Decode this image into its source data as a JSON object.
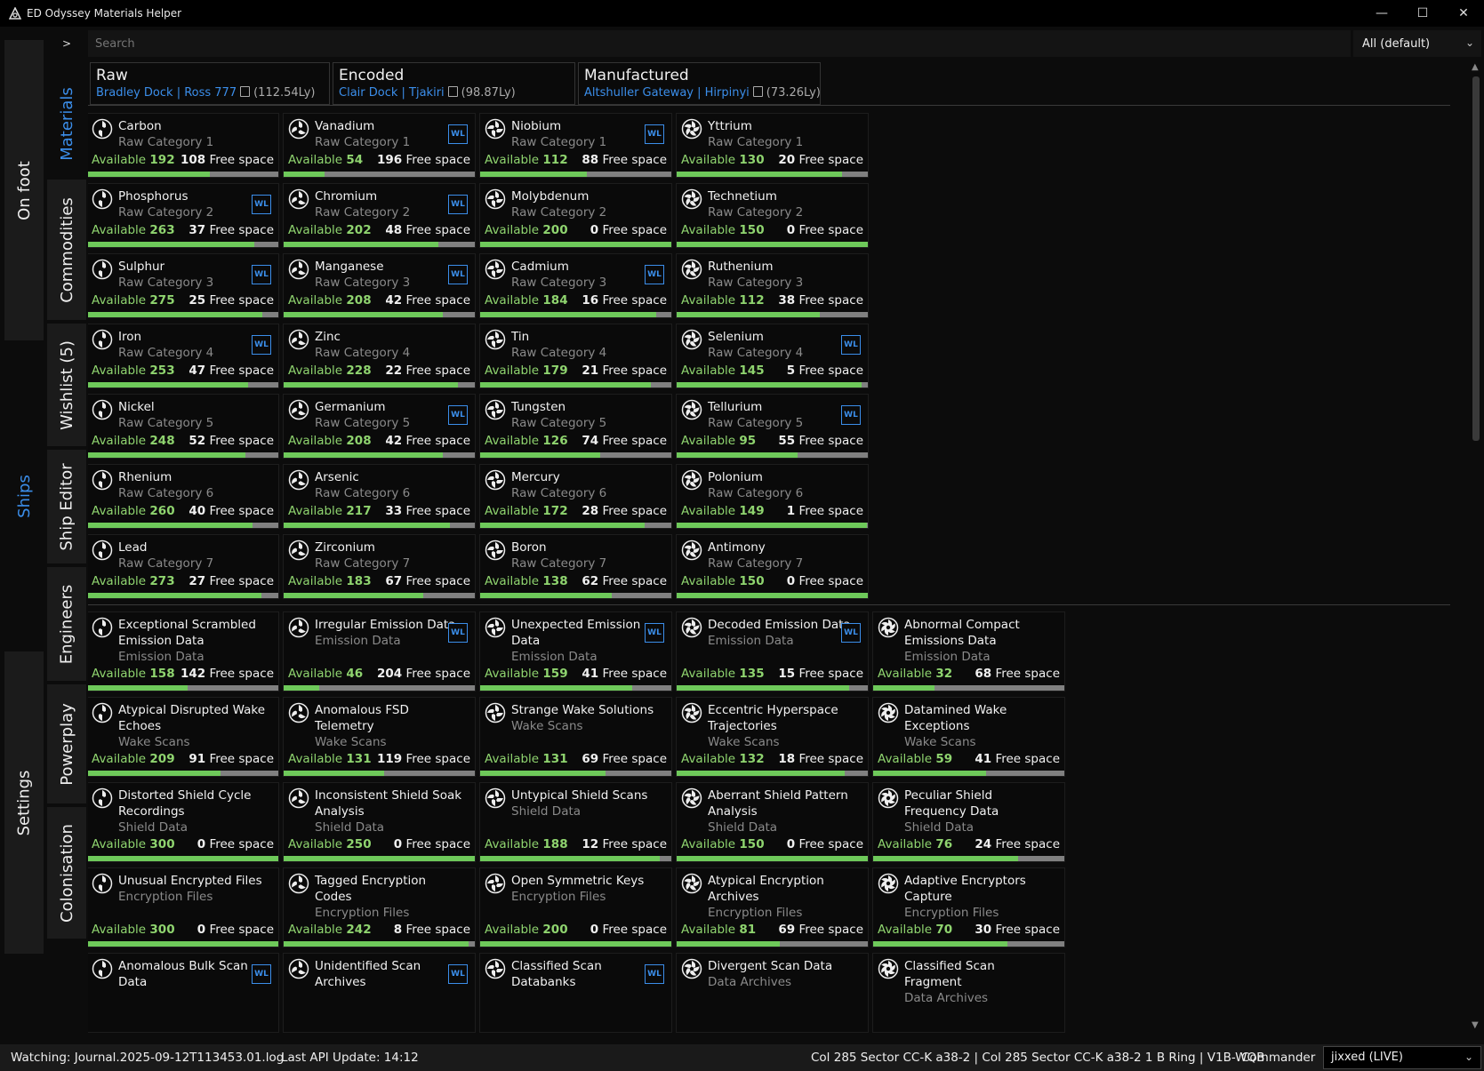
{
  "window": {
    "title": "ED Odyssey Materials Helper",
    "controls": [
      "minimize-icon",
      "maximize-icon",
      "close-icon"
    ]
  },
  "outer_tabs": [
    {
      "label": "On foot",
      "active": false
    },
    {
      "label": "Ships",
      "active": true
    },
    {
      "label": "Settings",
      "active": false
    }
  ],
  "inner_tabs": [
    {
      "label": "Materials",
      "active": true
    },
    {
      "label": "Commodities",
      "active": false
    },
    {
      "label": "Wishlist (5)",
      "active": false
    },
    {
      "label": "Ship Editor",
      "active": false
    },
    {
      "label": "Engineers",
      "active": false
    },
    {
      "label": "Powerplay",
      "active": false
    },
    {
      "label": "Colonisation",
      "active": false
    }
  ],
  "toolbar": {
    "expand_label": ">",
    "search_placeholder": "Search",
    "filter_value": "All (default)"
  },
  "traders": [
    {
      "name": "Raw",
      "location": "Bradley Dock | Ross 777",
      "distance": "(112.54Ly)"
    },
    {
      "name": "Encoded",
      "location": "Clair Dock | Tjakiri",
      "distance": "(98.87Ly)"
    },
    {
      "name": "Manufactured",
      "location": "Altshuller Gateway | Hirpinyi",
      "distance": "(73.26Ly)"
    }
  ],
  "labels": {
    "available": "Available",
    "free_space": "Free space",
    "wishlist_badge": "WL"
  },
  "raw_materials": [
    {
      "name": "Carbon",
      "category": "Raw Category 1",
      "available": 192,
      "free": 108,
      "wl": false,
      "grade": 1
    },
    {
      "name": "Vanadium",
      "category": "Raw Category 1",
      "available": 54,
      "free": 196,
      "wl": true,
      "grade": 2
    },
    {
      "name": "Niobium",
      "category": "Raw Category 1",
      "available": 112,
      "free": 88,
      "wl": true,
      "grade": 3
    },
    {
      "name": "Yttrium",
      "category": "Raw Category 1",
      "available": 130,
      "free": 20,
      "wl": false,
      "grade": 4
    },
    {
      "name": "Phosphorus",
      "category": "Raw Category 2",
      "available": 263,
      "free": 37,
      "wl": true,
      "grade": 1
    },
    {
      "name": "Chromium",
      "category": "Raw Category 2",
      "available": 202,
      "free": 48,
      "wl": true,
      "grade": 2
    },
    {
      "name": "Molybdenum",
      "category": "Raw Category 2",
      "available": 200,
      "free": 0,
      "wl": false,
      "grade": 3
    },
    {
      "name": "Technetium",
      "category": "Raw Category 2",
      "available": 150,
      "free": 0,
      "wl": false,
      "grade": 4
    },
    {
      "name": "Sulphur",
      "category": "Raw Category 3",
      "available": 275,
      "free": 25,
      "wl": true,
      "grade": 1
    },
    {
      "name": "Manganese",
      "category": "Raw Category 3",
      "available": 208,
      "free": 42,
      "wl": true,
      "grade": 2
    },
    {
      "name": "Cadmium",
      "category": "Raw Category 3",
      "available": 184,
      "free": 16,
      "wl": true,
      "grade": 3
    },
    {
      "name": "Ruthenium",
      "category": "Raw Category 3",
      "available": 112,
      "free": 38,
      "wl": false,
      "grade": 4
    },
    {
      "name": "Iron",
      "category": "Raw Category 4",
      "available": 253,
      "free": 47,
      "wl": true,
      "grade": 1
    },
    {
      "name": "Zinc",
      "category": "Raw Category 4",
      "available": 228,
      "free": 22,
      "wl": false,
      "grade": 2
    },
    {
      "name": "Tin",
      "category": "Raw Category 4",
      "available": 179,
      "free": 21,
      "wl": false,
      "grade": 3
    },
    {
      "name": "Selenium",
      "category": "Raw Category 4",
      "available": 145,
      "free": 5,
      "wl": true,
      "grade": 4
    },
    {
      "name": "Nickel",
      "category": "Raw Category 5",
      "available": 248,
      "free": 52,
      "wl": false,
      "grade": 1
    },
    {
      "name": "Germanium",
      "category": "Raw Category 5",
      "available": 208,
      "free": 42,
      "wl": true,
      "grade": 2
    },
    {
      "name": "Tungsten",
      "category": "Raw Category 5",
      "available": 126,
      "free": 74,
      "wl": false,
      "grade": 3
    },
    {
      "name": "Tellurium",
      "category": "Raw Category 5",
      "available": 95,
      "free": 55,
      "wl": true,
      "grade": 4
    },
    {
      "name": "Rhenium",
      "category": "Raw Category 6",
      "available": 260,
      "free": 40,
      "wl": false,
      "grade": 1
    },
    {
      "name": "Arsenic",
      "category": "Raw Category 6",
      "available": 217,
      "free": 33,
      "wl": false,
      "grade": 2
    },
    {
      "name": "Mercury",
      "category": "Raw Category 6",
      "available": 172,
      "free": 28,
      "wl": false,
      "grade": 3
    },
    {
      "name": "Polonium",
      "category": "Raw Category 6",
      "available": 149,
      "free": 1,
      "wl": false,
      "grade": 4
    },
    {
      "name": "Lead",
      "category": "Raw Category 7",
      "available": 273,
      "free": 27,
      "wl": false,
      "grade": 1
    },
    {
      "name": "Zirconium",
      "category": "Raw Category 7",
      "available": 183,
      "free": 67,
      "wl": false,
      "grade": 2
    },
    {
      "name": "Boron",
      "category": "Raw Category 7",
      "available": 138,
      "free": 62,
      "wl": false,
      "grade": 3
    },
    {
      "name": "Antimony",
      "category": "Raw Category 7",
      "available": 150,
      "free": 0,
      "wl": false,
      "grade": 4
    }
  ],
  "encoded_materials": [
    {
      "name": "Exceptional Scrambled Emission Data",
      "category": "Emission Data",
      "available": 158,
      "free": 142,
      "wl": false,
      "grade": 1
    },
    {
      "name": "Irregular Emission Data",
      "category": "Emission Data",
      "available": 46,
      "free": 204,
      "wl": true,
      "grade": 2
    },
    {
      "name": "Unexpected Emission Data",
      "category": "Emission Data",
      "available": 159,
      "free": 41,
      "wl": true,
      "grade": 3
    },
    {
      "name": "Decoded Emission Data",
      "category": "Emission Data",
      "available": 135,
      "free": 15,
      "wl": true,
      "grade": 4
    },
    {
      "name": "Abnormal Compact Emissions Data",
      "category": "Emission Data",
      "available": 32,
      "free": 68,
      "wl": false,
      "grade": 5
    },
    {
      "name": "Atypical Disrupted Wake Echoes",
      "category": "Wake Scans",
      "available": 209,
      "free": 91,
      "wl": false,
      "grade": 1
    },
    {
      "name": "Anomalous FSD Telemetry",
      "category": "Wake Scans",
      "available": 131,
      "free": 119,
      "wl": false,
      "grade": 2
    },
    {
      "name": "Strange Wake Solutions",
      "category": "Wake Scans",
      "available": 131,
      "free": 69,
      "wl": false,
      "grade": 3
    },
    {
      "name": "Eccentric Hyperspace Trajectories",
      "category": "Wake Scans",
      "available": 132,
      "free": 18,
      "wl": false,
      "grade": 4
    },
    {
      "name": "Datamined Wake Exceptions",
      "category": "Wake Scans",
      "available": 59,
      "free": 41,
      "wl": false,
      "grade": 5
    },
    {
      "name": "Distorted Shield Cycle Recordings",
      "category": "Shield Data",
      "available": 300,
      "free": 0,
      "wl": false,
      "grade": 1
    },
    {
      "name": "Inconsistent Shield Soak Analysis",
      "category": "Shield Data",
      "available": 250,
      "free": 0,
      "wl": false,
      "grade": 2
    },
    {
      "name": "Untypical Shield Scans",
      "category": "Shield Data",
      "available": 188,
      "free": 12,
      "wl": false,
      "grade": 3
    },
    {
      "name": "Aberrant Shield Pattern Analysis",
      "category": "Shield Data",
      "available": 150,
      "free": 0,
      "wl": false,
      "grade": 4
    },
    {
      "name": "Peculiar Shield Frequency Data",
      "category": "Shield Data",
      "available": 76,
      "free": 24,
      "wl": false,
      "grade": 5
    },
    {
      "name": "Unusual Encrypted Files",
      "category": "Encryption Files",
      "available": 300,
      "free": 0,
      "wl": false,
      "grade": 1
    },
    {
      "name": "Tagged Encryption Codes",
      "category": "Encryption Files",
      "available": 242,
      "free": 8,
      "wl": false,
      "grade": 2
    },
    {
      "name": "Open Symmetric Keys",
      "category": "Encryption Files",
      "available": 200,
      "free": 0,
      "wl": false,
      "grade": 3
    },
    {
      "name": "Atypical Encryption Archives",
      "category": "Encryption Files",
      "available": 81,
      "free": 69,
      "wl": false,
      "grade": 4
    },
    {
      "name": "Adaptive Encryptors Capture",
      "category": "Encryption Files",
      "available": 70,
      "free": 30,
      "wl": false,
      "grade": 5
    },
    {
      "name": "Anomalous Bulk Scan Data",
      "category": "",
      "available": null,
      "free": null,
      "wl": true,
      "grade": 1
    },
    {
      "name": "Unidentified Scan Archives",
      "category": "",
      "available": null,
      "free": null,
      "wl": true,
      "grade": 2
    },
    {
      "name": "Classified Scan Databanks",
      "category": "",
      "available": null,
      "free": null,
      "wl": true,
      "grade": 3
    },
    {
      "name": "Divergent Scan Data",
      "category": "Data Archives",
      "available": null,
      "free": null,
      "wl": false,
      "grade": 4
    },
    {
      "name": "Classified Scan Fragment",
      "category": "Data Archives",
      "available": null,
      "free": null,
      "wl": false,
      "grade": 5
    }
  ],
  "status": {
    "watching": "Watching: Journal.2025-09-12T113453.01.log",
    "api_update": "Last API Update: 14:12",
    "location": "Col 285 Sector CC-K a38-2 | Col 285 Sector CC-K a38-2 1 B Ring | V1B-WQB",
    "commander_label": "Commander",
    "commander_value": "jixxed (LIVE)"
  },
  "colors": {
    "accent": "#3b8eea",
    "available": "#8fd46f",
    "bar_fill": "#6ec95a",
    "bar_bg": "#808080"
  }
}
